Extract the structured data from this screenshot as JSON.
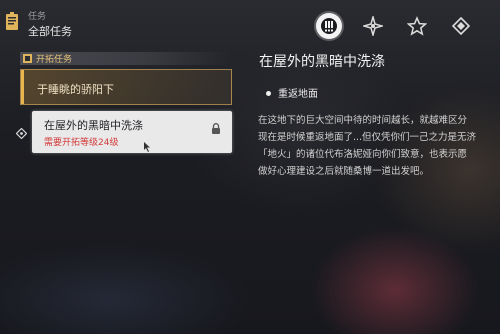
{
  "header": {
    "section_small": "任务",
    "section_title": "全部任务"
  },
  "tabs": [
    {
      "name": "tab-main-quests",
      "active": true
    },
    {
      "name": "tab-trailblaze",
      "active": false
    },
    {
      "name": "tab-companion",
      "active": false
    },
    {
      "name": "tab-adventure",
      "active": false
    }
  ],
  "quest_list": {
    "category_label": "开拓任务",
    "quests": [
      {
        "title": "于睡眺的骄阳下"
      },
      {
        "title": "在屋外的黑暗中洗涤",
        "requirement": "需要开拓等级24级",
        "locked": true
      }
    ]
  },
  "detail": {
    "title": "在屋外的黑暗中洗涤",
    "objective": "重返地面",
    "description": [
      "在这地下的巨大空间中待的时间越长，就越难区分",
      "现在是时候重返地面了...但仅凭你们一己之力是无济",
      "「地火」的诸位代布洛妮娅向你们致意，也表示愿",
      "做好心理建设之后就随桑博一道出发吧。"
    ]
  },
  "colors": {
    "accent_gold": "#e8b54e",
    "requirement_red": "#d33a3a"
  }
}
